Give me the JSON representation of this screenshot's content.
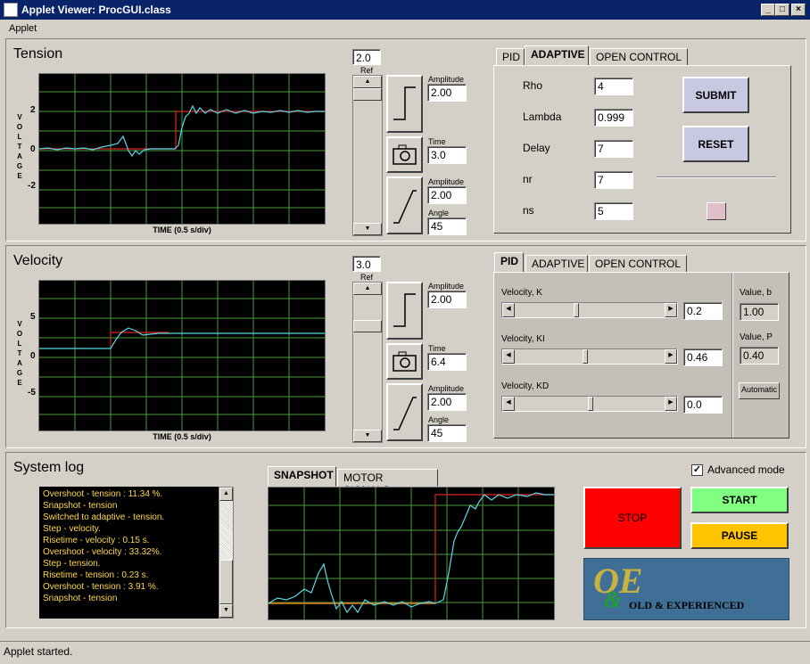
{
  "window": {
    "title": "Applet Viewer: ProcGUI.class",
    "min": "_",
    "max": "□",
    "close": "×"
  },
  "menu": {
    "applet": "Applet"
  },
  "tension": {
    "title": "Tension",
    "ref_value": "2.0",
    "ref_label": "Ref",
    "step_amp_label": "Amplitude",
    "step_amp": "2.00",
    "time_label": "Time",
    "time": "3.0",
    "ramp_amp_label": "Amplitude",
    "ramp_amp": "2.00",
    "angle_label": "Angle",
    "angle": "45",
    "xlabel": "TIME (0.5 s/div)",
    "ylabel_letters": [
      "V",
      "O",
      "L",
      "T",
      "A",
      "G",
      "E"
    ],
    "yticks": [
      "2",
      "0",
      "-2"
    ],
    "tabs": [
      "PID",
      "ADAPTIVE",
      "OPEN CONTROL"
    ],
    "params": [
      {
        "label": "Rho",
        "value": "4"
      },
      {
        "label": "Lambda",
        "value": "0.999"
      },
      {
        "label": "Delay",
        "value": "7"
      },
      {
        "label": "nr",
        "value": "7"
      },
      {
        "label": "ns",
        "value": "5"
      }
    ],
    "submit": "SUBMIT",
    "reset": "RESET"
  },
  "velocity": {
    "title": "Velocity",
    "ref_value": "3.0",
    "ref_label": "Ref",
    "step_amp_label": "Amplitude",
    "step_amp": "2.00",
    "time_label": "Time",
    "time": "6.4",
    "ramp_amp_label": "Amplitude",
    "ramp_amp": "2.00",
    "angle_label": "Angle",
    "angle": "45",
    "xlabel": "TIME (0.5 s/div)",
    "ylabel_letters": [
      "V",
      "O",
      "L",
      "T",
      "A",
      "G",
      "E"
    ],
    "yticks": [
      "5",
      "0",
      "-5"
    ],
    "tabs": [
      "PID",
      "ADAPTIVE",
      "OPEN CONTROL"
    ],
    "sliders": [
      {
        "label": "Velocity, K",
        "value": "0.2"
      },
      {
        "label": "Velocity, KI",
        "value": "0.46"
      },
      {
        "label": "Velocity, KD",
        "value": "0.0"
      }
    ],
    "value_b_label": "Value, b",
    "value_b": "1.00",
    "value_p_label": "Value, P",
    "value_p": "0.40",
    "automatic": "Automatic"
  },
  "syslog": {
    "title": "System log",
    "lines": [
      "Overshoot - tension : 11.34 %.",
      "Snapshot - tension",
      "Switched to adaptive - tension.",
      "Step - velocity.",
      "Risetime - velocity : 0.15 s.",
      "Overshoot - velocity : 33.32%.",
      "Step - tension.",
      "Risetime - tension : 0.23 s.",
      "Overshoot - tension : 3.91 %.",
      "Snapshot - tension"
    ],
    "tabs": [
      "SNAPSHOT",
      "MOTOR SIGNALS"
    ],
    "advanced_mode": "Advanced mode",
    "stop": "STOP",
    "start": "START",
    "pause": "PAUSE",
    "logo_big": "OE",
    "logo_amp": "&",
    "logo_text": "OLD & EXPERIENCED"
  },
  "status": "Applet started.",
  "colors": {
    "stop": "#ff0000",
    "start": "#80ff80",
    "pause": "#ffc400",
    "logo_bg": "#3f6f96",
    "trace": "#5ad8e6",
    "ref": "#e02020",
    "grid": "#4a9a3a"
  }
}
